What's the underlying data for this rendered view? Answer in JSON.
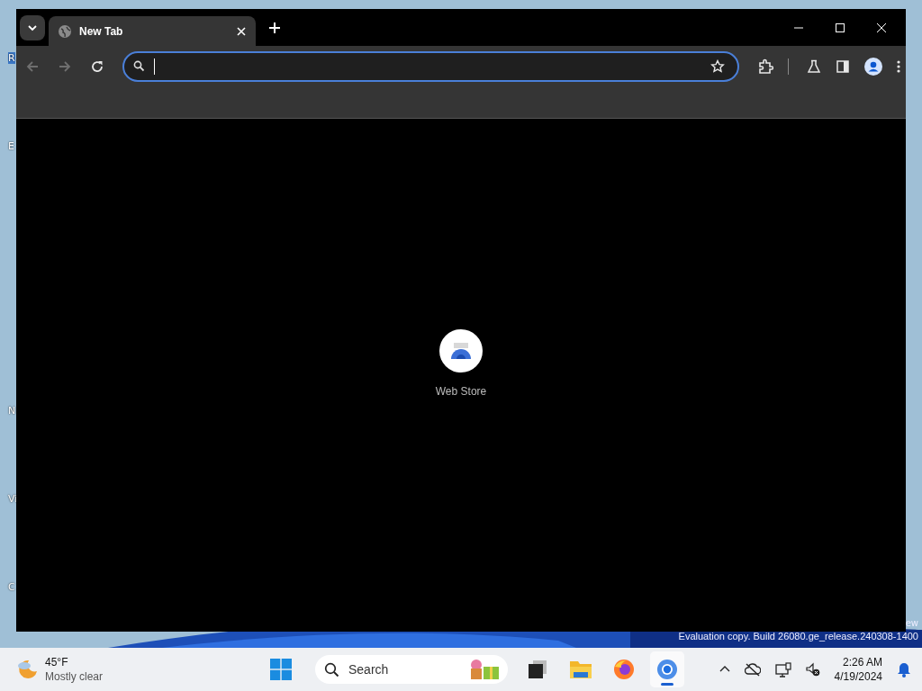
{
  "desktop": {
    "icon_labels": [
      {
        "label": "R",
        "selected": true
      },
      {
        "label": "E",
        "selected": false
      },
      {
        "label": "N",
        "selected": false
      },
      {
        "label": "Vi",
        "selected": false
      },
      {
        "label": "C",
        "selected": false
      }
    ],
    "watermark": {
      "edition": "ew",
      "build": "Evaluation copy. Build 26080.ge_release.240308-1400"
    }
  },
  "browser": {
    "tabs": [
      {
        "title": "New Tab",
        "selected": true
      }
    ],
    "toolbar": {
      "back": {
        "disabled": true
      },
      "forward": {
        "disabled": true
      },
      "address": {
        "focused": true
      }
    },
    "shortcuts": [
      {
        "label": "Web Store"
      }
    ]
  },
  "taskbar": {
    "weather": {
      "temperature": "45°F",
      "condition": "Mostly clear"
    },
    "search": {
      "placeholder": "Search"
    },
    "apps": [
      {
        "kind": "taskview",
        "selected": false
      },
      {
        "kind": "files",
        "selected": false
      },
      {
        "kind": "firefox",
        "selected": false
      },
      {
        "kind": "chrome",
        "selected": true
      }
    ],
    "clock": {
      "time": "2:26 AM",
      "date": "4/19/2024"
    }
  }
}
